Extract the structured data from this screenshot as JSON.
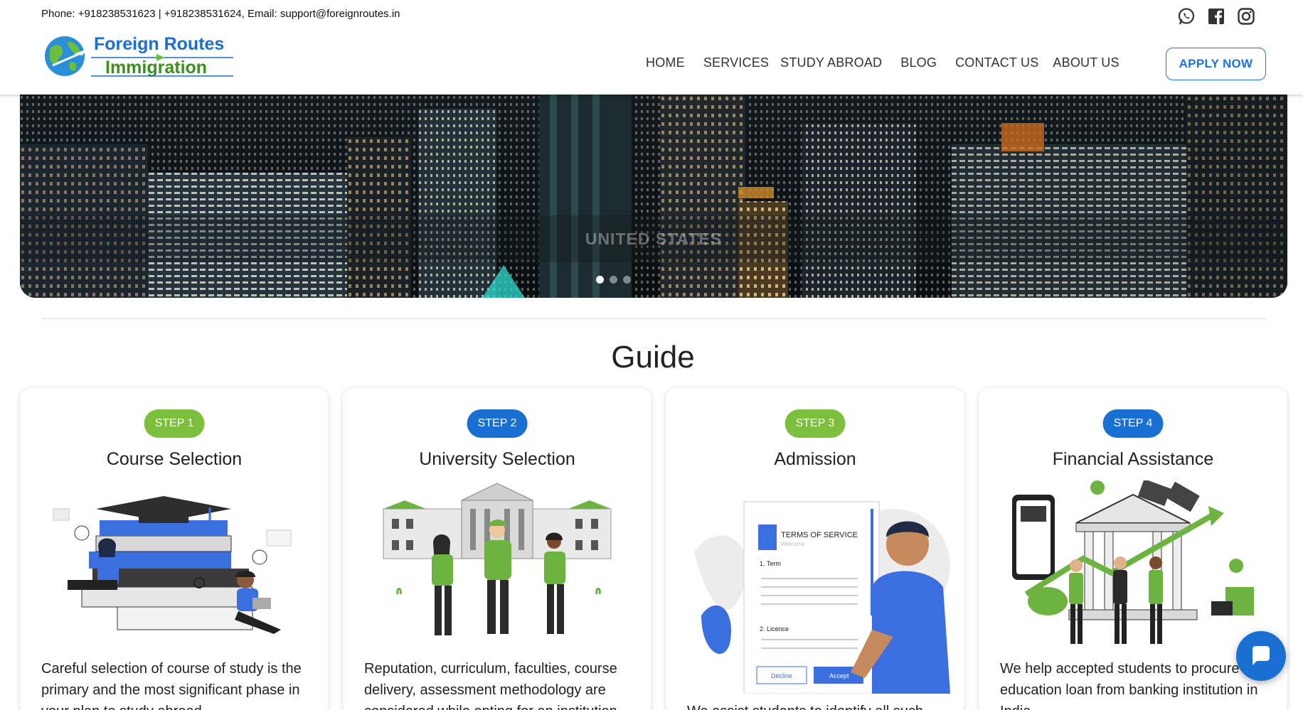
{
  "topbar": {
    "contact": "Phone: +918238531623 | +918238531624, Email: support@foreignroutes.in"
  },
  "brand": {
    "line1": "Foreign Routes",
    "line2": "Immigration",
    "colors": {
      "blue": "#1a6fd3",
      "green": "#3e8e1f"
    }
  },
  "socials": [
    "whatsapp-icon",
    "facebook-icon",
    "instagram-icon"
  ],
  "nav": {
    "items": [
      "HOME",
      "SERVICES",
      "STUDY ABROAD",
      "BLOG",
      "CONTACT US",
      "ABOUT US"
    ],
    "cta": "APPLY NOW"
  },
  "hero": {
    "caption": "UNITED STATES",
    "slides": 3,
    "active_slide": 1
  },
  "guide": {
    "title": "Guide",
    "steps": [
      {
        "badge": "STEP 1",
        "color": "#7cbf3c",
        "title": "Course Selection",
        "text": "Careful selection of course of study is the primary and the most significant phase in your plan to study abroad."
      },
      {
        "badge": "STEP 2",
        "color": "#1a6fd3",
        "title": "University Selection",
        "text": "Reputation, curriculum, faculties, course delivery, assessment methodology are considered while opting for an institution."
      },
      {
        "badge": "STEP 3",
        "color": "#7cbf3c",
        "title": "Admission",
        "text": "We assist students to identify all such"
      },
      {
        "badge": "STEP 4",
        "color": "#1a6fd3",
        "title": "Financial Assistance",
        "text": "We help accepted students to procure education loan from banking institution in India."
      }
    ],
    "illustration_labels": {
      "terms": "TERMS OF SERVICE",
      "welcome": "Welcome",
      "term": "1. Term",
      "licence": "2. Licence",
      "decline": "Decline",
      "accept": "Accept"
    }
  },
  "chat": {
    "icon": "chat-bubble-icon"
  }
}
